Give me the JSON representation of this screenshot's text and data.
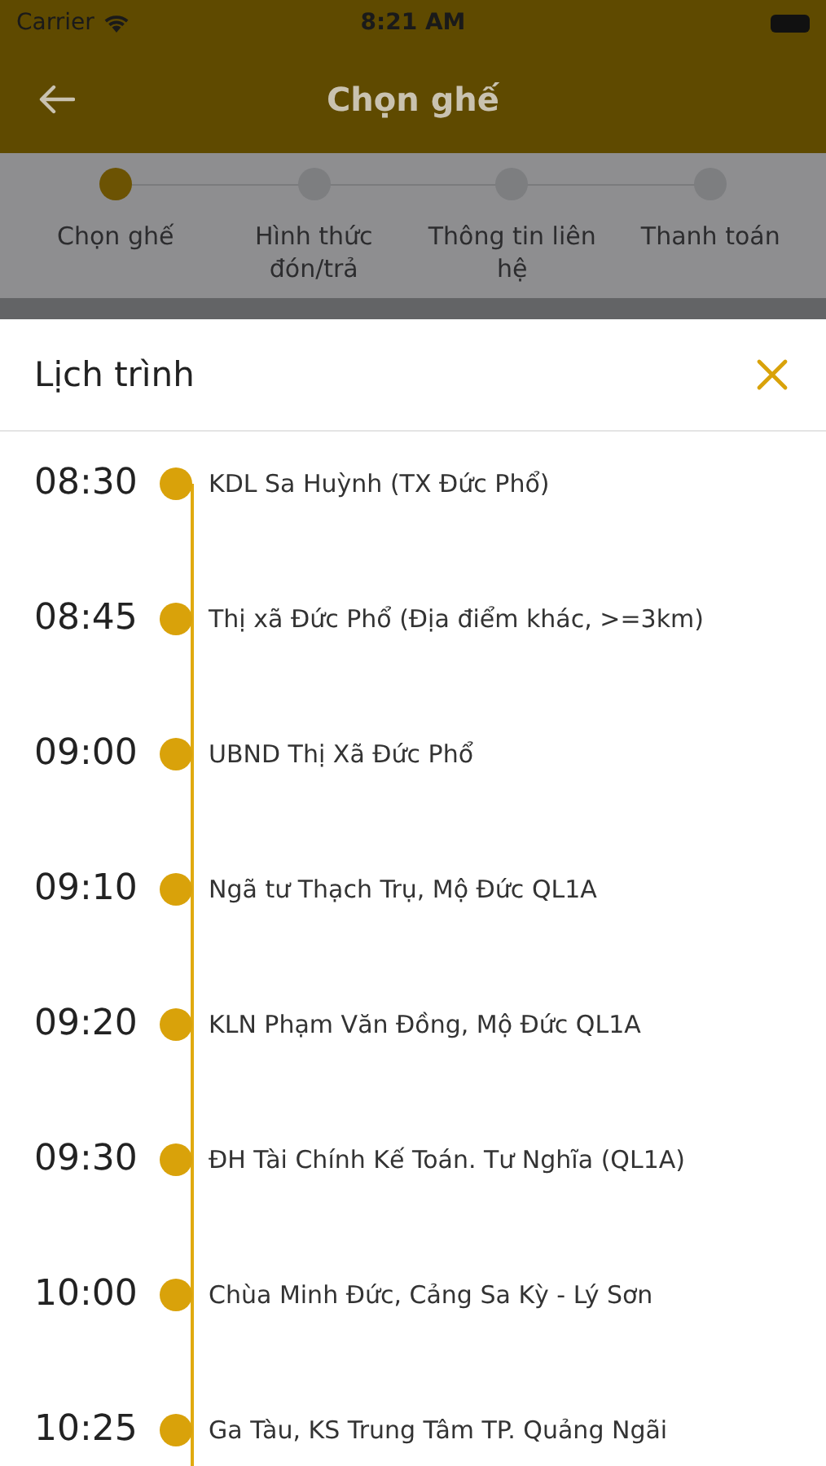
{
  "status_bar": {
    "carrier": "Carrier",
    "time": "8:21 AM"
  },
  "header": {
    "title": "Chọn ghế"
  },
  "steps": [
    {
      "label": "Chọn ghế",
      "selected": true
    },
    {
      "label": "Hình thức đón/trả",
      "selected": false
    },
    {
      "label": "Thông tin liên hệ",
      "selected": false
    },
    {
      "label": "Thanh toán",
      "selected": false
    }
  ],
  "sheet": {
    "title": "Lịch trình"
  },
  "schedule": [
    {
      "time": "08:30",
      "place": "KDL Sa Huỳnh (TX Đức Phổ)"
    },
    {
      "time": "08:45",
      "place": "Thị xã Đức Phổ (Địa điểm khác, >=3km)"
    },
    {
      "time": "09:00",
      "place": "UBND Thị Xã Đức Phổ"
    },
    {
      "time": "09:10",
      "place": "Ngã tư Thạch Trụ, Mộ Đức QL1A"
    },
    {
      "time": "09:20",
      "place": "KLN Phạm Văn Đồng, Mộ Đức QL1A"
    },
    {
      "time": "09:30",
      "place": "ĐH Tài Chính Kế Toán. Tư Nghĩa (QL1A)"
    },
    {
      "time": "10:00",
      "place": "Chùa Minh Đức, Cảng Sa Kỳ - Lý Sơn"
    },
    {
      "time": "10:25",
      "place": "Ga Tàu, KS Trung Tâm TP. Quảng Ngãi"
    }
  ]
}
